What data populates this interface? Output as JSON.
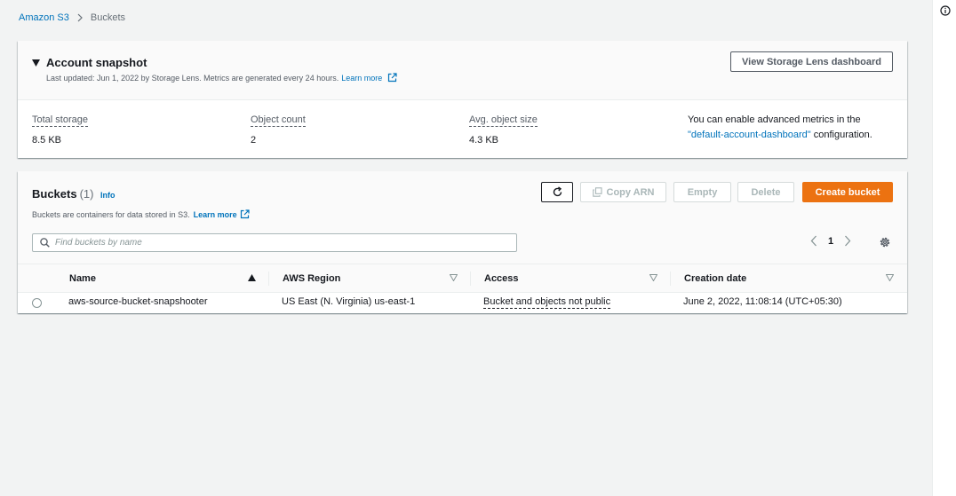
{
  "breadcrumb": {
    "root": "Amazon S3",
    "current": "Buckets"
  },
  "snapshot": {
    "title": "Account snapshot",
    "subtitle": "Last updated: Jun 1, 2022 by Storage Lens. Metrics are generated every 24 hours.",
    "learn_more": "Learn more",
    "lens_button": "View Storage Lens dashboard",
    "metrics": [
      {
        "label": "Total storage",
        "value": "8.5 KB"
      },
      {
        "label": "Object count",
        "value": "2"
      },
      {
        "label": "Avg. object size",
        "value": "4.3 KB"
      }
    ],
    "advanced_pre": "You can enable advanced metrics in the",
    "advanced_link": "\"default-account-dashboard\"",
    "advanced_post": " configuration."
  },
  "buckets": {
    "title": "Buckets",
    "count": "(1)",
    "info": "Info",
    "subtitle": "Buckets are containers for data stored in S3.",
    "learn_more": "Learn more",
    "buttons": {
      "copy_arn": "Copy ARN",
      "empty": "Empty",
      "delete": "Delete",
      "create": "Create bucket"
    },
    "search_placeholder": "Find buckets by name",
    "page": "1",
    "columns": [
      "Name",
      "AWS Region",
      "Access",
      "Creation date"
    ],
    "rows": [
      {
        "name": "aws-source-bucket-snapshooter",
        "region": "US East (N. Virginia) us-east-1",
        "access": "Bucket and objects not public",
        "created": "June 2, 2022, 11:08:14 (UTC+05:30)"
      }
    ]
  },
  "colors": {
    "link": "#0073bb",
    "primary": "#ec7211",
    "background": "#f2f3f3"
  }
}
